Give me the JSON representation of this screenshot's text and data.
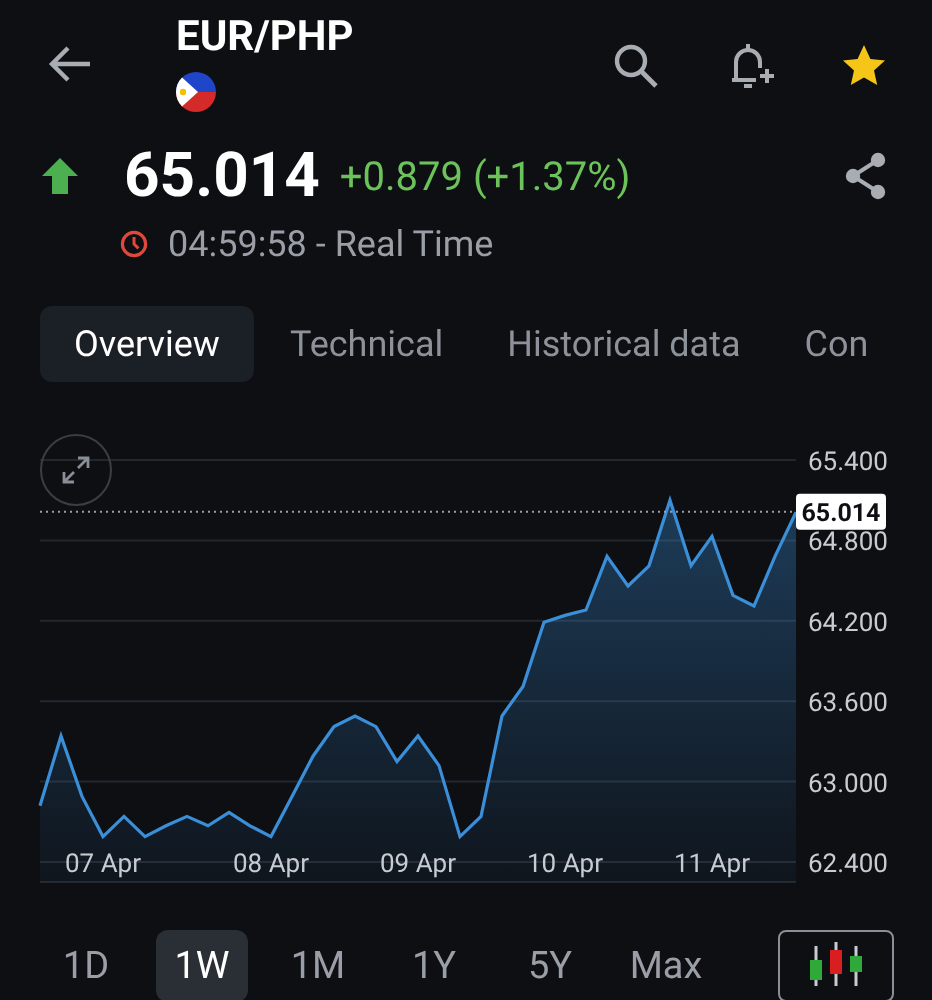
{
  "header": {
    "title": "EUR/PHP",
    "favorite": true
  },
  "quote": {
    "price": "65.014",
    "change": "+0.879 (+1.37%)",
    "time": "04:59:58 - Real Time"
  },
  "tabs": [
    {
      "label": "Overview",
      "selected": true
    },
    {
      "label": "Technical",
      "selected": false
    },
    {
      "label": "Historical data",
      "selected": false
    },
    {
      "label": "Con",
      "selected": false
    }
  ],
  "chart": {
    "chart_data": {
      "type": "area",
      "grid": true,
      "ref_lines": [
        {
          "axis": "y",
          "value": 65.014,
          "label": "65.014"
        }
      ],
      "categories": [
        null,
        null,
        null,
        "07 Apr",
        null,
        null,
        null,
        null,
        null,
        null,
        null,
        "08 Apr",
        null,
        null,
        null,
        null,
        null,
        null,
        "09 Apr",
        null,
        null,
        null,
        null,
        null,
        null,
        "10 Apr",
        null,
        null,
        null,
        null,
        null,
        null,
        "11 Apr",
        null,
        null,
        null,
        null
      ],
      "series": [
        {
          "color": "#3b8fd9",
          "values": [
            62.82,
            63.34,
            62.89,
            62.59,
            62.74,
            62.59,
            62.67,
            62.74,
            62.67,
            62.77,
            62.67,
            62.59,
            62.89,
            63.19,
            63.41,
            63.49,
            63.41,
            63.15,
            63.34,
            63.12,
            62.59,
            62.74,
            63.49,
            63.71,
            64.19,
            64.24,
            64.28,
            64.68,
            64.46,
            64.61,
            65.1,
            64.61,
            64.83,
            64.39,
            64.31,
            64.68,
            65.01
          ]
        }
      ],
      "ylim": [
        62.4,
        65.4
      ],
      "yticks": [
        {
          "value": 65.4,
          "label": "65.400"
        },
        {
          "value": 64.8,
          "label": "64.800"
        },
        {
          "value": 64.2,
          "label": "64.200"
        },
        {
          "value": 63.6,
          "label": "63.600"
        },
        {
          "value": 63.0,
          "label": "63.000"
        },
        {
          "value": 62.4,
          "label": "62.400"
        }
      ]
    }
  },
  "ranges": [
    {
      "label": "1D",
      "selected": false
    },
    {
      "label": "1W",
      "selected": true
    },
    {
      "label": "1M",
      "selected": false
    },
    {
      "label": "1Y",
      "selected": false
    },
    {
      "label": "5Y",
      "selected": false
    },
    {
      "label": "Max",
      "selected": false
    }
  ]
}
